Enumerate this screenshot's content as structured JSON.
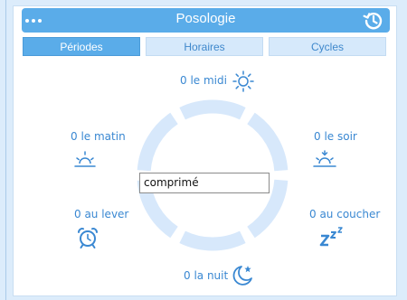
{
  "header": {
    "title": "Posologie"
  },
  "tabs": [
    {
      "label": "Périodes",
      "active": true
    },
    {
      "label": "Horaires",
      "active": false
    },
    {
      "label": "Cycles",
      "active": false
    }
  ],
  "periods": {
    "midi": "0 le midi",
    "matin": "0 le matin",
    "soir": "0 le soir",
    "lever": "0 au lever",
    "coucher": "0 au coucher",
    "nuit": "0 la nuit"
  },
  "unit_field": {
    "value": "comprimé"
  },
  "colors": {
    "accent": "#5aace9",
    "text": "#3a88d2",
    "ring": "#d7e8fb",
    "background": "#dcecfb"
  }
}
